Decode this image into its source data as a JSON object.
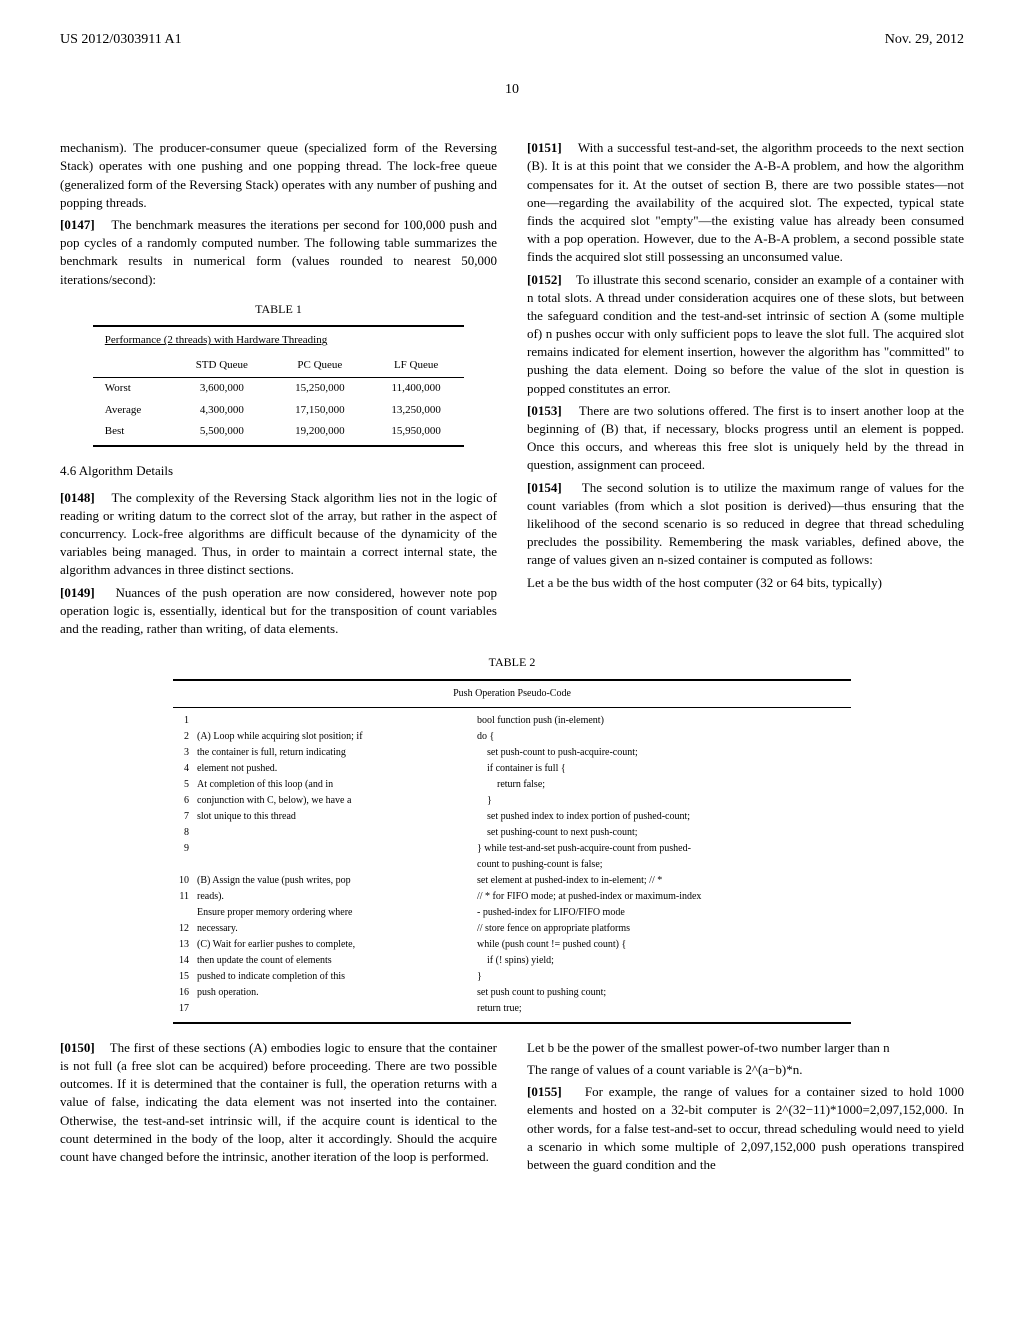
{
  "header": {
    "left": "US 2012/0303911 A1",
    "right": "Nov. 29, 2012"
  },
  "page_number": "10",
  "col_left": {
    "p1": "mechanism). The producer-consumer queue (specialized form of the Reversing Stack) operates with one pushing and one popping thread. The lock-free queue (generalized form of the Reversing Stack) operates with any number of pushing and popping threads.",
    "p2_num": "[0147]",
    "p2": "The benchmark measures the iterations per second for 100,000 push and pop cycles of a randomly computed number. The following table summarizes the benchmark results in numerical form (values rounded to nearest 50,000 iterations/second):",
    "table1": {
      "title": "TABLE 1",
      "subtitle": "Performance (2 threads) with Hardware Threading",
      "headers": [
        "",
        "STD Queue",
        "PC Queue",
        "LF Queue"
      ],
      "rows": [
        [
          "Worst",
          "3,600,000",
          "15,250,000",
          "11,400,000"
        ],
        [
          "Average",
          "4,300,000",
          "17,150,000",
          "13,250,000"
        ],
        [
          "Best",
          "5,500,000",
          "19,200,000",
          "15,950,000"
        ]
      ]
    },
    "section_heading": "4.6 Algorithm Details",
    "p3_num": "[0148]",
    "p3": "The complexity of the Reversing Stack algorithm lies not in the logic of reading or writing datum to the correct slot of the array, but rather in the aspect of concurrency. Lock-free algorithms are difficult because of the dynamicity of the variables being managed. Thus, in order to maintain a correct internal state, the algorithm advances in three distinct sections.",
    "p4_num": "[0149]",
    "p4": "Nuances of the push operation are now considered, however note pop operation logic is, essentially, identical but for the transposition of count variables and the reading, rather than writing, of data elements."
  },
  "col_right": {
    "p1_num": "[0151]",
    "p1": "With a successful test-and-set, the algorithm proceeds to the next section (B). It is at this point that we consider the A-B-A problem, and how the algorithm compensates for it. At the outset of section B, there are two possible states—not one—regarding the availability of the acquired slot. The expected, typical state finds the acquired slot \"empty\"—the existing value has already been consumed with a pop operation. However, due to the A-B-A problem, a second possible state finds the acquired slot still possessing an unconsumed value.",
    "p2_num": "[0152]",
    "p2": "To illustrate this second scenario, consider an example of a container with n total slots. A thread under consideration acquires one of these slots, but between the safeguard condition and the test-and-set intrinsic of section A (some multiple of) n pushes occur with only sufficient pops to leave the slot full. The acquired slot remains indicated for element insertion, however the algorithm has \"committed\" to pushing the data element. Doing so before the value of the slot in question is popped constitutes an error.",
    "p3_num": "[0153]",
    "p3": "There are two solutions offered. The first is to insert another loop at the beginning of (B) that, if necessary, blocks progress until an element is popped. Once this occurs, and whereas this free slot is uniquely held by the thread in question, assignment can proceed.",
    "p4_num": "[0154]",
    "p4": "The second solution is to utilize the maximum range of values for the count variables (from which a slot position is derived)—thus ensuring that the likelihood of the second scenario is so reduced in degree that thread scheduling precludes the possibility. Remembering the mask variables, defined above, the range of values given an n-sized container is computed as follows:",
    "p5": "Let a be the bus width of the host computer (32 or 64 bits, typically)"
  },
  "table2": {
    "title": "TABLE 2",
    "subtitle": "Push Operation Pseudo-Code",
    "rows": [
      {
        "num": "1",
        "left": "",
        "right": "bool function push (in-element)"
      },
      {
        "num": "2",
        "left": "(A) Loop while acquiring slot position; if",
        "right": "do {"
      },
      {
        "num": "3",
        "left": "the container is full, return indicating",
        "right": "    set push-count to push-acquire-count;"
      },
      {
        "num": "4",
        "left": "element not pushed.",
        "right": "    if container is full {"
      },
      {
        "num": "5",
        "left": "At completion of this loop (and in",
        "right": "        return false;"
      },
      {
        "num": "6",
        "left": "conjunction with C, below), we have a",
        "right": "    }"
      },
      {
        "num": "7",
        "left": "slot unique to this thread",
        "right": "    set pushed index to index portion of pushed-count;"
      },
      {
        "num": "8",
        "left": "",
        "right": "    set pushing-count to next push-count;"
      },
      {
        "num": "9",
        "left": "",
        "right": "} while test-and-set push-acquire-count from pushed-"
      },
      {
        "num": "",
        "left": "",
        "right": "count to pushing-count is false;"
      },
      {
        "num": "10",
        "left": "(B) Assign the value (push writes, pop",
        "right": "set element at pushed-index to in-element; // *"
      },
      {
        "num": "11",
        "left": "reads).",
        "right": "// * for FIFO mode; at pushed-index or maximum-index"
      },
      {
        "num": "",
        "left": "Ensure proper memory ordering where",
        "right": "- pushed-index for LIFO/FIFO mode"
      },
      {
        "num": "12",
        "left": "necessary.",
        "right": "// store fence on appropriate platforms"
      },
      {
        "num": "13",
        "left": "(C) Wait for earlier pushes to complete,",
        "right": "while (push count != pushed count) {"
      },
      {
        "num": "14",
        "left": "then update the count of elements",
        "right": "    if (! spins) yield;"
      },
      {
        "num": "15",
        "left": "pushed to indicate completion of this",
        "right": "}"
      },
      {
        "num": "16",
        "left": "push operation.",
        "right": "set push count to pushing count;"
      },
      {
        "num": "17",
        "left": "",
        "right": "return true;"
      }
    ]
  },
  "bottom_left": {
    "p1_num": "[0150]",
    "p1": "The first of these sections (A) embodies logic to ensure that the container is not full (a free slot can be acquired) before proceeding. There are two possible outcomes. If it is determined that the container is full, the operation returns with a value of false, indicating the data element was not inserted into the container. Otherwise, the test-and-set intrinsic will, if the acquire count is identical to the count determined in the body of the loop, alter it accordingly. Should the acquire count have changed before the intrinsic, another iteration of the loop is performed."
  },
  "bottom_right": {
    "p1": "Let b be the power of the smallest power-of-two number larger than n",
    "p2": "The range of values of a count variable is 2^(a−b)*n.",
    "p3_num": "[0155]",
    "p3": "For example, the range of values for a container sized to hold 1000 elements and hosted on a 32-bit computer is 2^(32−11)*1000=2,097,152,000. In other words, for a false test-and-set to occur, thread scheduling would need to yield a scenario in which some multiple of 2,097,152,000 push operations transpired between the guard condition and the"
  },
  "chart_data": {
    "type": "table",
    "title": "Performance (2 threads) with Hardware Threading",
    "categories": [
      "Worst",
      "Average",
      "Best"
    ],
    "series": [
      {
        "name": "STD Queue",
        "values": [
          3600000,
          4300000,
          5500000
        ]
      },
      {
        "name": "PC Queue",
        "values": [
          15250000,
          17150000,
          19200000
        ]
      },
      {
        "name": "LF Queue",
        "values": [
          11400000,
          13250000,
          15950000
        ]
      }
    ]
  }
}
